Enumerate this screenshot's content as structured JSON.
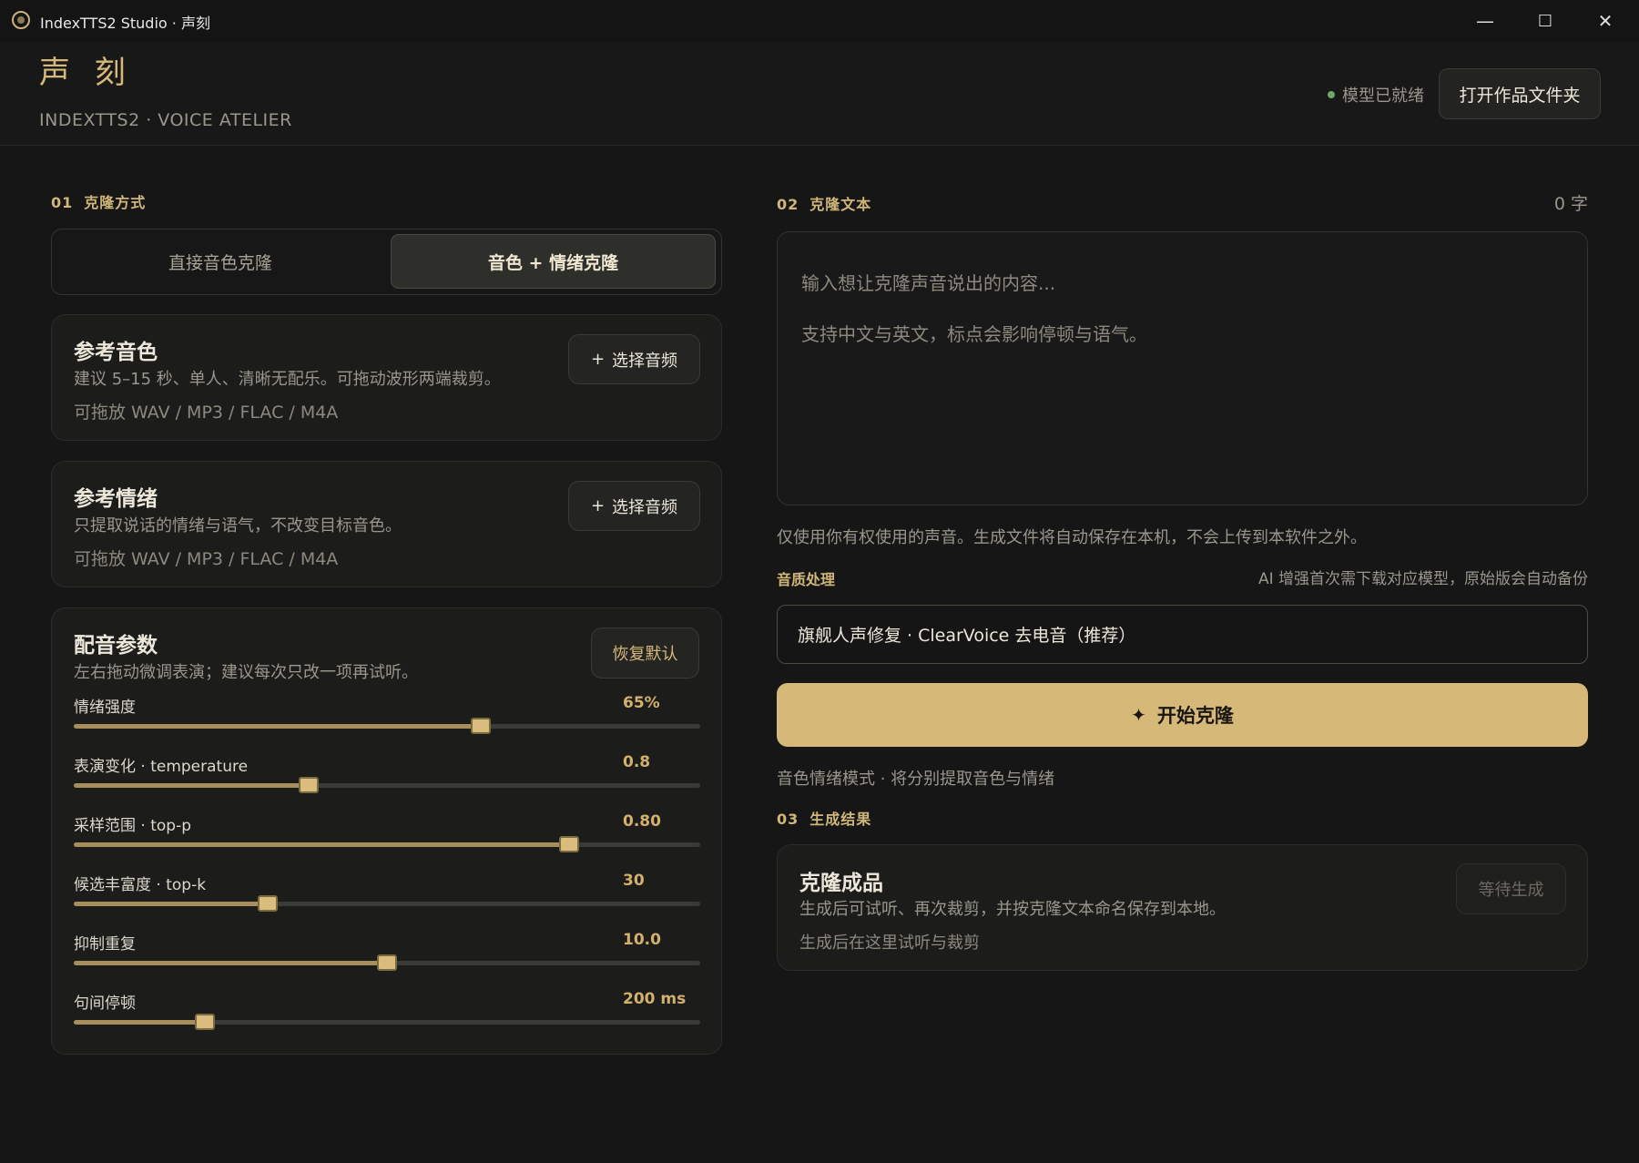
{
  "window": {
    "title": "IndexTTS2 Studio · 声刻",
    "minimize": "—",
    "maximize": "☐",
    "close": "✕"
  },
  "header": {
    "brand_title": "声 刻",
    "brand_subtitle": "INDEXTTS2 · VOICE ATELIER",
    "status_text": "模型已就绪",
    "open_folder_label": "打开作品文件夹"
  },
  "left": {
    "section_num": "01",
    "section_title": "克隆方式",
    "tabs": [
      {
        "label": "直接音色克隆",
        "active": false
      },
      {
        "label": "音色 + 情绪克隆",
        "active": true
      }
    ],
    "voice_card": {
      "title": "参考音色",
      "desc": "建议 5–15 秒、单人、清晰无配乐。可拖动波形两端裁剪。",
      "formats": "可拖放 WAV / MP3 / FLAC / M4A",
      "button_plus": "+",
      "button_label": "选择音频"
    },
    "emotion_card": {
      "title": "参考情绪",
      "desc": "只提取说话的情绪与语气，不改变目标音色。",
      "formats": "可拖放 WAV / MP3 / FLAC / M4A",
      "button_plus": "+",
      "button_label": "选择音频"
    },
    "params_card": {
      "title": "配音参数",
      "desc": "左右拖动微调表演；建议每次只改一项再试听。",
      "reset_label": "恢复默认",
      "params": [
        {
          "label": "情绪强度",
          "value": "65%",
          "level": 0.65
        },
        {
          "label": "表演变化 · temperature",
          "value": "0.8",
          "level": 0.375
        },
        {
          "label": "采样范围 · top-p",
          "value": "0.80",
          "level": 0.79
        },
        {
          "label": "候选丰富度 · top-k",
          "value": "30",
          "level": 0.31
        },
        {
          "label": "抑制重复",
          "value": "10.0",
          "level": 0.5
        },
        {
          "label": "句间停顿",
          "value": "200 ms",
          "level": 0.21
        }
      ]
    }
  },
  "right": {
    "section_num": "02",
    "section_title": "克隆文本",
    "char_count": "0 字",
    "text_placeholder": "输入想让克隆声音说出的内容...\n支持中文与英文，标点会影响停顿与语气。",
    "privacy_note": "仅使用你有权使用的声音。生成文件将自动保存在本机，不会上传到本软件之外。",
    "quality_label": "音质处理",
    "quality_hint": "AI 增强首次需下载对应模型，原始版会自动备份",
    "quality_selected": "旗舰人声修复 · ClearVoice 去电音（推荐）",
    "start_icon": "✦",
    "start_label": "开始克隆",
    "mode_hint": "音色情绪模式 · 将分别提取音色与情绪",
    "result_num": "03",
    "result_title": "生成结果",
    "result_card": {
      "title": "克隆成品",
      "desc": "生成后可试听、再次裁剪，并按克隆文本命名保存到本地。",
      "sub": "生成后在这里试听与裁剪",
      "badge": "等待生成"
    }
  }
}
